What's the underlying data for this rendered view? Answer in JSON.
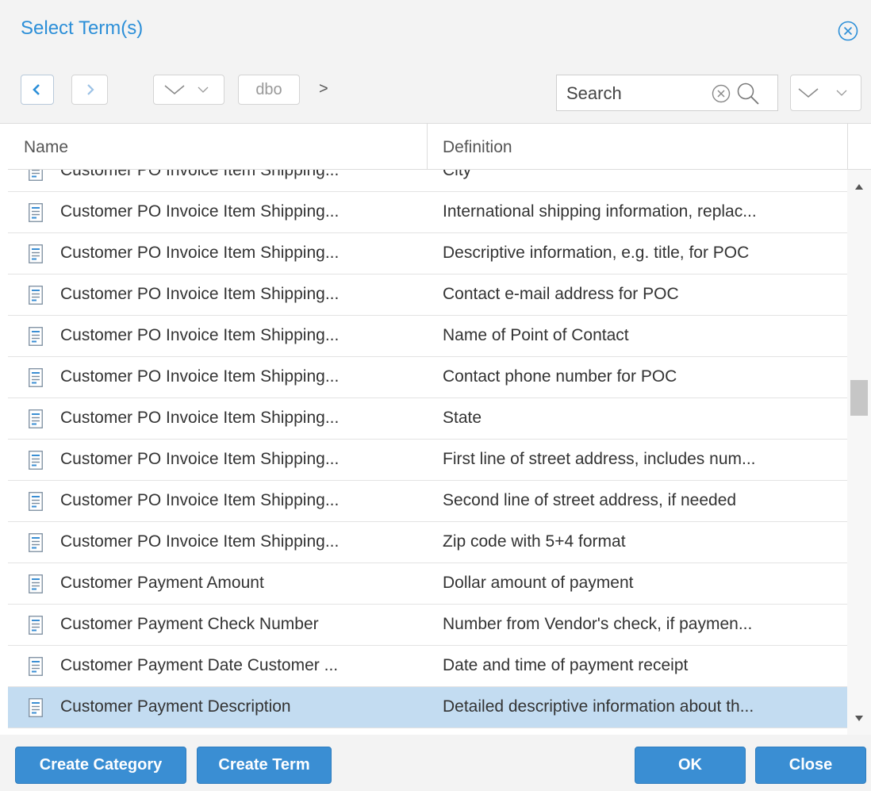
{
  "dialog": {
    "title": "Select Term(s)",
    "close_icon": "close-circle-icon"
  },
  "toolbar": {
    "back_icon": "chevron-left-icon",
    "forward_icon": "chevron-right-icon",
    "dropdown_icon": "chevron-down-icon",
    "crumb": "dbo",
    "crumb_separator": ">",
    "search_placeholder": "Search",
    "search_value": "",
    "colors": {
      "accent": "#2c8fd8"
    }
  },
  "table": {
    "columns": [
      "Name",
      "Definition"
    ],
    "rows": [
      {
        "name": "Customer PO Invoice Item Shipping...",
        "definition": "City"
      },
      {
        "name": "Customer PO Invoice Item Shipping...",
        "definition": "International shipping information, replac..."
      },
      {
        "name": "Customer PO Invoice Item Shipping...",
        "definition": "Descriptive information, e.g. title, for POC"
      },
      {
        "name": "Customer PO Invoice Item Shipping...",
        "definition": "Contact e-mail address for POC"
      },
      {
        "name": "Customer PO Invoice Item Shipping...",
        "definition": "Name of Point of Contact"
      },
      {
        "name": "Customer PO Invoice Item Shipping...",
        "definition": "Contact phone number for POC"
      },
      {
        "name": "Customer PO Invoice Item Shipping...",
        "definition": "State"
      },
      {
        "name": "Customer PO Invoice Item Shipping...",
        "definition": "First line of street address, includes num..."
      },
      {
        "name": "Customer PO Invoice Item Shipping...",
        "definition": "Second line of street address, if needed"
      },
      {
        "name": "Customer PO Invoice Item Shipping...",
        "definition": "Zip code with 5+4 format"
      },
      {
        "name": "Customer Payment Amount",
        "definition": "Dollar amount of payment"
      },
      {
        "name": "Customer Payment Check Number",
        "definition": "Number from Vendor's check, if paymen..."
      },
      {
        "name": "Customer Payment Date Customer ...",
        "definition": "Date and time of payment receipt"
      },
      {
        "name": "Customer Payment Description",
        "definition": "Detailed descriptive information about th...",
        "selected": true
      }
    ],
    "row_icon": "term-document-icon",
    "selected_color": "#c3dcf1"
  },
  "footer": {
    "create_category": "Create Category",
    "create_term": "Create Term",
    "ok": "OK",
    "close": "Close",
    "button_color": "#3a8ed3"
  }
}
